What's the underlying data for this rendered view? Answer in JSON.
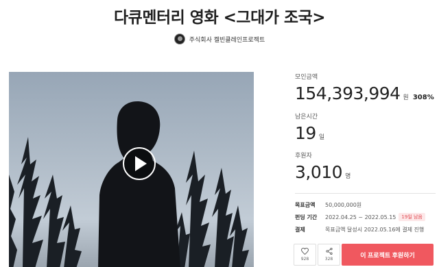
{
  "project": {
    "title": "다큐멘터리 영화 <그대가 조국>",
    "creator": "주식회사 켈빈클레인프로젝트"
  },
  "stats": {
    "raised_label": "모인금액",
    "raised_value": "154,393,994",
    "raised_unit": "원",
    "raised_percent": "308%",
    "time_label": "남은시간",
    "time_value": "19",
    "time_unit": "일",
    "backers_label": "후원자",
    "backers_value": "3,010",
    "backers_unit": "명"
  },
  "info": {
    "goal_label": "목표금액",
    "goal_value": "50,000,000원",
    "period_label": "펀딩 기간",
    "period_value": "2022.04.25 ~ 2022.05.15",
    "period_badge": "19일 남음",
    "payment_label": "결제",
    "payment_value": "목표금액 달성시 2022.05.16에 결제 진행"
  },
  "actions": {
    "like_count": "928",
    "share_count": "328",
    "fund_label": "이 프로젝트 후원하기"
  },
  "colors": {
    "accent": "#f0585f",
    "badge_bg": "#fde8e9"
  },
  "icons": {
    "like": "heart-icon",
    "share": "share-icon",
    "play": "play-icon"
  }
}
